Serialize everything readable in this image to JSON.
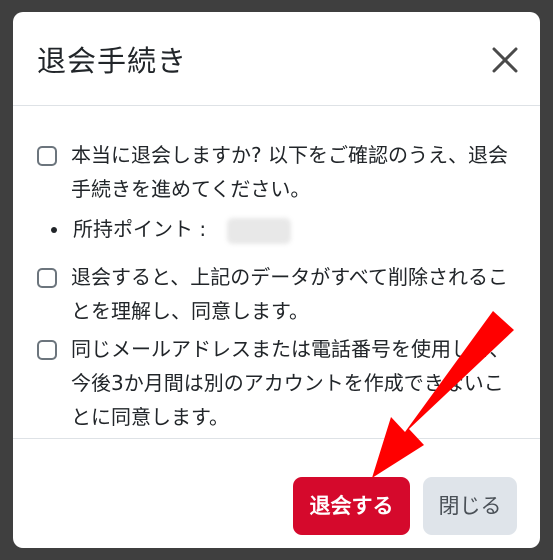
{
  "modal": {
    "title": "退会手続き",
    "close_icon": "close-icon"
  },
  "body": {
    "checkbox1_text": "本当に退会しますか? 以下をご確認のうえ、退会手続きを進めてください。",
    "points_label": "所持ポイント :",
    "checkbox2_text": "退会すると、上記のデータがすべて削除されることを理解し、同意します。",
    "checkbox3_text": "同じメールアドレスまたは電話番号を使用して、今後3か月間は別のアカウントを作成できないことに同意します。"
  },
  "footer": {
    "withdraw_label": "退会する",
    "close_label": "閉じる"
  },
  "colors": {
    "danger": "#d5092c",
    "secondary": "#dfe4ea",
    "annotation_arrow": "#ff0000"
  }
}
